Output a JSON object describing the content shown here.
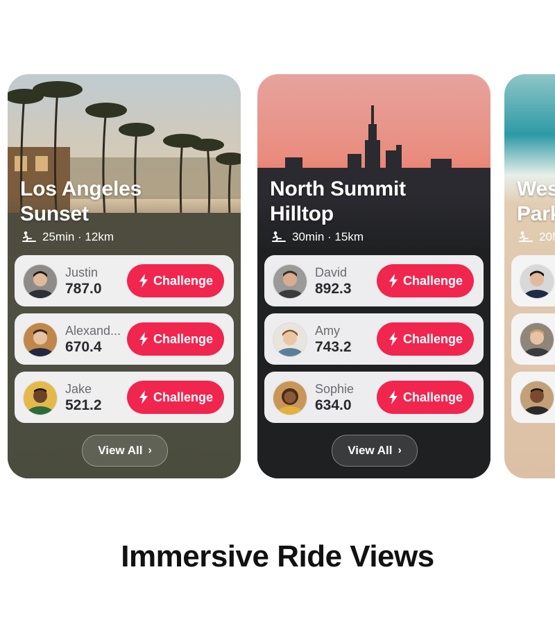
{
  "caption": "Immersive Ride Views",
  "colors": {
    "challenge": "#f0264f",
    "white": "#ffffff"
  },
  "cards": [
    {
      "title_line1": "Los Angeles",
      "title_line2": "Sunset",
      "meta": "25min · 12km",
      "meta_icon": "rowing-machine-icon",
      "riders": [
        {
          "name": "Justin",
          "score": "787.0",
          "challenge": "Challenge"
        },
        {
          "name": "Alexand...",
          "score": "670.4",
          "challenge": "Challenge"
        },
        {
          "name": "Jake",
          "score": "521.2",
          "challenge": "Challenge"
        }
      ],
      "view_all": "View All"
    },
    {
      "title_line1": "North Summit",
      "title_line2": "Hilltop",
      "meta": "30min · 15km",
      "meta_icon": "rowing-machine-icon",
      "riders": [
        {
          "name": "David",
          "score": "892.3",
          "challenge": "Challenge"
        },
        {
          "name": "Amy",
          "score": "743.2",
          "challenge": "Challenge"
        },
        {
          "name": "Sophie",
          "score": "634.0",
          "challenge": "Challenge"
        }
      ],
      "view_all": "View All"
    },
    {
      "title_line1": "Wes",
      "title_line2": "Park",
      "meta": "20M",
      "meta_icon": "rowing-machine-icon"
    }
  ]
}
